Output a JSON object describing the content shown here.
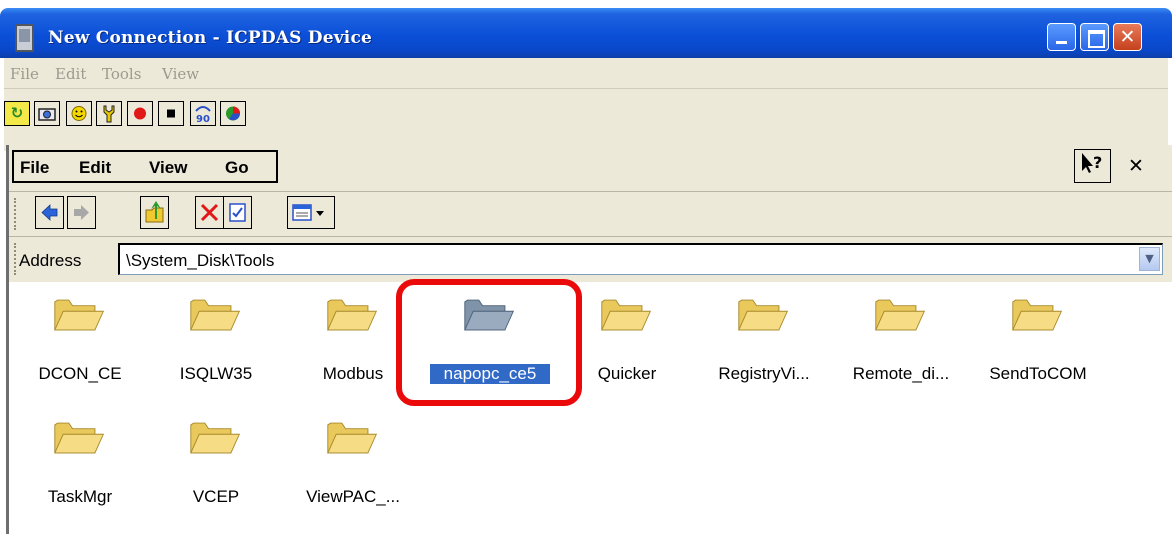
{
  "window": {
    "title": "New Connection - ICPDAS Device",
    "controls": {
      "minimize": "_",
      "maximize": "□",
      "close": "✕"
    }
  },
  "outer_menu": [
    "File",
    "Edit",
    "Tools",
    "View"
  ],
  "inner_menu": [
    "File",
    "Edit",
    "View",
    "Go"
  ],
  "help_label": "↖?",
  "inner_close": "✕",
  "address": {
    "label": "Address",
    "value": "\\System_Disk\\Tools"
  },
  "folders": [
    "DCON_CE",
    "ISQLW35",
    "Modbus",
    "napopc_ce5",
    "Quicker",
    "RegistryVi...",
    "Remote_di...",
    "SendToCOM",
    "TaskMgr",
    "VCEP",
    "ViewPAC_..."
  ],
  "selected_folder": "napopc_ce5",
  "colors": {
    "title_bar": "#0b4fd8",
    "selection": "#3169c6",
    "highlight_box": "#ea0a0a",
    "folder": "#f5dc85"
  }
}
